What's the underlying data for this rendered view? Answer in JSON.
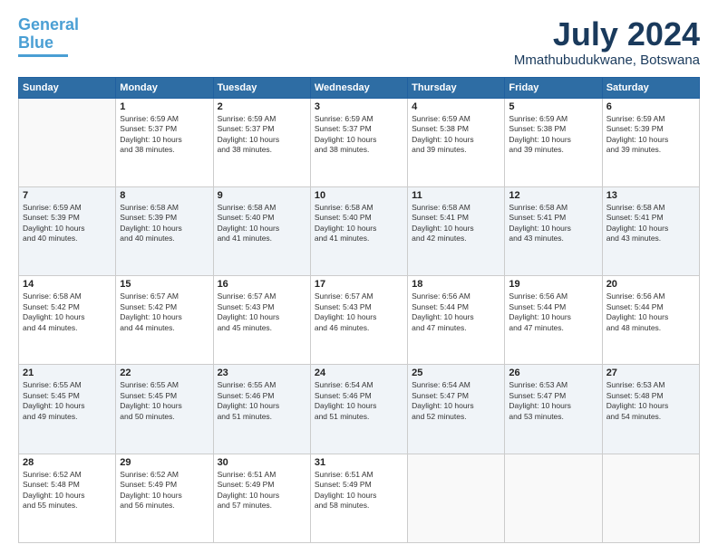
{
  "header": {
    "logo_line1": "General",
    "logo_line2": "Blue",
    "month": "July 2024",
    "location": "Mmathubudukwane, Botswana"
  },
  "weekdays": [
    "Sunday",
    "Monday",
    "Tuesday",
    "Wednesday",
    "Thursday",
    "Friday",
    "Saturday"
  ],
  "weeks": [
    [
      {
        "day": "",
        "info": ""
      },
      {
        "day": "1",
        "info": "Sunrise: 6:59 AM\nSunset: 5:37 PM\nDaylight: 10 hours\nand 38 minutes."
      },
      {
        "day": "2",
        "info": "Sunrise: 6:59 AM\nSunset: 5:37 PM\nDaylight: 10 hours\nand 38 minutes."
      },
      {
        "day": "3",
        "info": "Sunrise: 6:59 AM\nSunset: 5:37 PM\nDaylight: 10 hours\nand 38 minutes."
      },
      {
        "day": "4",
        "info": "Sunrise: 6:59 AM\nSunset: 5:38 PM\nDaylight: 10 hours\nand 39 minutes."
      },
      {
        "day": "5",
        "info": "Sunrise: 6:59 AM\nSunset: 5:38 PM\nDaylight: 10 hours\nand 39 minutes."
      },
      {
        "day": "6",
        "info": "Sunrise: 6:59 AM\nSunset: 5:39 PM\nDaylight: 10 hours\nand 39 minutes."
      }
    ],
    [
      {
        "day": "7",
        "info": "Sunrise: 6:59 AM\nSunset: 5:39 PM\nDaylight: 10 hours\nand 40 minutes."
      },
      {
        "day": "8",
        "info": "Sunrise: 6:58 AM\nSunset: 5:39 PM\nDaylight: 10 hours\nand 40 minutes."
      },
      {
        "day": "9",
        "info": "Sunrise: 6:58 AM\nSunset: 5:40 PM\nDaylight: 10 hours\nand 41 minutes."
      },
      {
        "day": "10",
        "info": "Sunrise: 6:58 AM\nSunset: 5:40 PM\nDaylight: 10 hours\nand 41 minutes."
      },
      {
        "day": "11",
        "info": "Sunrise: 6:58 AM\nSunset: 5:41 PM\nDaylight: 10 hours\nand 42 minutes."
      },
      {
        "day": "12",
        "info": "Sunrise: 6:58 AM\nSunset: 5:41 PM\nDaylight: 10 hours\nand 43 minutes."
      },
      {
        "day": "13",
        "info": "Sunrise: 6:58 AM\nSunset: 5:41 PM\nDaylight: 10 hours\nand 43 minutes."
      }
    ],
    [
      {
        "day": "14",
        "info": "Sunrise: 6:58 AM\nSunset: 5:42 PM\nDaylight: 10 hours\nand 44 minutes."
      },
      {
        "day": "15",
        "info": "Sunrise: 6:57 AM\nSunset: 5:42 PM\nDaylight: 10 hours\nand 44 minutes."
      },
      {
        "day": "16",
        "info": "Sunrise: 6:57 AM\nSunset: 5:43 PM\nDaylight: 10 hours\nand 45 minutes."
      },
      {
        "day": "17",
        "info": "Sunrise: 6:57 AM\nSunset: 5:43 PM\nDaylight: 10 hours\nand 46 minutes."
      },
      {
        "day": "18",
        "info": "Sunrise: 6:56 AM\nSunset: 5:44 PM\nDaylight: 10 hours\nand 47 minutes."
      },
      {
        "day": "19",
        "info": "Sunrise: 6:56 AM\nSunset: 5:44 PM\nDaylight: 10 hours\nand 47 minutes."
      },
      {
        "day": "20",
        "info": "Sunrise: 6:56 AM\nSunset: 5:44 PM\nDaylight: 10 hours\nand 48 minutes."
      }
    ],
    [
      {
        "day": "21",
        "info": "Sunrise: 6:55 AM\nSunset: 5:45 PM\nDaylight: 10 hours\nand 49 minutes."
      },
      {
        "day": "22",
        "info": "Sunrise: 6:55 AM\nSunset: 5:45 PM\nDaylight: 10 hours\nand 50 minutes."
      },
      {
        "day": "23",
        "info": "Sunrise: 6:55 AM\nSunset: 5:46 PM\nDaylight: 10 hours\nand 51 minutes."
      },
      {
        "day": "24",
        "info": "Sunrise: 6:54 AM\nSunset: 5:46 PM\nDaylight: 10 hours\nand 51 minutes."
      },
      {
        "day": "25",
        "info": "Sunrise: 6:54 AM\nSunset: 5:47 PM\nDaylight: 10 hours\nand 52 minutes."
      },
      {
        "day": "26",
        "info": "Sunrise: 6:53 AM\nSunset: 5:47 PM\nDaylight: 10 hours\nand 53 minutes."
      },
      {
        "day": "27",
        "info": "Sunrise: 6:53 AM\nSunset: 5:48 PM\nDaylight: 10 hours\nand 54 minutes."
      }
    ],
    [
      {
        "day": "28",
        "info": "Sunrise: 6:52 AM\nSunset: 5:48 PM\nDaylight: 10 hours\nand 55 minutes."
      },
      {
        "day": "29",
        "info": "Sunrise: 6:52 AM\nSunset: 5:49 PM\nDaylight: 10 hours\nand 56 minutes."
      },
      {
        "day": "30",
        "info": "Sunrise: 6:51 AM\nSunset: 5:49 PM\nDaylight: 10 hours\nand 57 minutes."
      },
      {
        "day": "31",
        "info": "Sunrise: 6:51 AM\nSunset: 5:49 PM\nDaylight: 10 hours\nand 58 minutes."
      },
      {
        "day": "",
        "info": ""
      },
      {
        "day": "",
        "info": ""
      },
      {
        "day": "",
        "info": ""
      }
    ]
  ]
}
